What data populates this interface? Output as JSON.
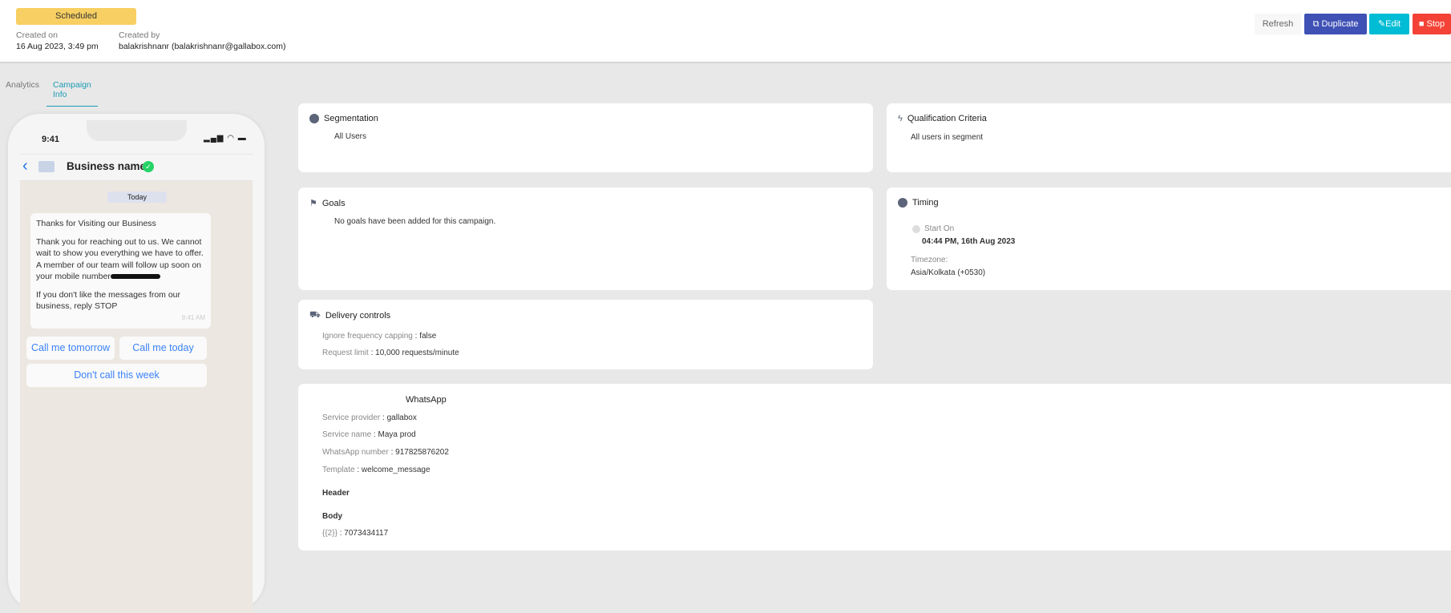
{
  "header": {
    "status": "Scheduled",
    "created_on_label": "Created on",
    "created_on": "16 Aug 2023, 3:49 pm",
    "created_by_label": "Created by",
    "created_by": "balakrishnanr (balakrishnanr@gallabox.com)"
  },
  "actions": {
    "refresh": "Refresh",
    "duplicate": "Duplicate",
    "edit": "Edit",
    "stop": "Stop"
  },
  "tabs": [
    "Analytics",
    "Campaign Info"
  ],
  "phone": {
    "time": "9:41",
    "business_name": "Business name",
    "date_chip": "Today",
    "message_title": "Thanks for Visiting our Business",
    "message_body": "Thank you for reaching out to us. We cannot wait to show you everything we have to offer. A member of our team will follow up soon on your mobile number",
    "message_footer": "If you don't like the messages from our business, reply STOP",
    "message_time": "9:41 AM",
    "quick_replies": [
      "Call me tomorrow",
      "Call me today",
      "Don't call this week"
    ]
  },
  "segmentation": {
    "title": "Segmentation",
    "value": "All Users"
  },
  "qualification": {
    "title": "Qualification Criteria",
    "value": "All users in segment"
  },
  "goals": {
    "title": "Goals",
    "value": "No goals have been added for this campaign."
  },
  "timing": {
    "title": "Timing",
    "start_label": "Start On",
    "start_value": "04:44 PM, 16th Aug 2023",
    "tz_label": "Timezone:",
    "tz_value": "Asia/Kolkata (+0530)"
  },
  "delivery": {
    "title": "Delivery controls",
    "ifc_label": "Ignore frequency capping",
    "ifc_value": "false",
    "rl_label": "Request limit",
    "rl_value": "10,000 requests/minute"
  },
  "whatsapp": {
    "title": "WhatsApp",
    "rows": [
      {
        "label": "Service provider",
        "value": "gallabox"
      },
      {
        "label": "Service name",
        "value": "Maya prod"
      },
      {
        "label": "WhatsApp number",
        "value": "917825876202"
      },
      {
        "label": "Template",
        "value": "welcome_message"
      }
    ],
    "header_label": "Header",
    "body_label": "Body",
    "var_label": "{{2}}",
    "var_value": "7073434117"
  }
}
